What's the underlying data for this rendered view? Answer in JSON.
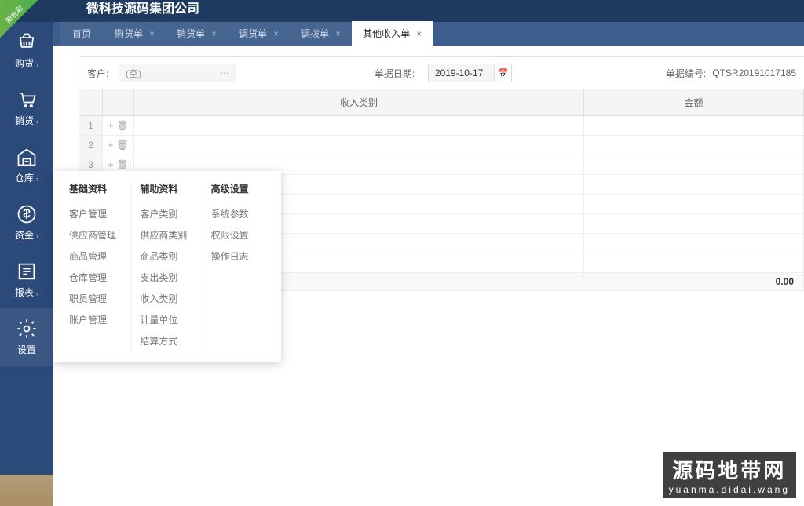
{
  "ribbon": "新色彩",
  "company": "微科技源码集团公司",
  "sidebar": [
    {
      "label": "购货",
      "icon": "basket"
    },
    {
      "label": "销货",
      "icon": "cart"
    },
    {
      "label": "仓库",
      "icon": "warehouse"
    },
    {
      "label": "资金",
      "icon": "money"
    },
    {
      "label": "报表",
      "icon": "report"
    },
    {
      "label": "设置",
      "icon": "gear"
    }
  ],
  "tabs": {
    "home": "首页",
    "items": [
      {
        "label": "购货单"
      },
      {
        "label": "销货单"
      },
      {
        "label": "调货单"
      },
      {
        "label": "调拨单"
      }
    ],
    "active": "其他收入单"
  },
  "form": {
    "customer_label": "客户:",
    "customer_value": "(空)",
    "date_label": "单据日期:",
    "date_value": "2019-10-17",
    "orderno_label": "单据编号:",
    "orderno_value": "QTSR20191017185"
  },
  "table": {
    "col_type": "收入类别",
    "col_amount": "金额",
    "rows": [
      1,
      2,
      3
    ],
    "total": "0.00"
  },
  "popup": {
    "cols": [
      {
        "title": "基础资料",
        "items": [
          "客户管理",
          "供应商管理",
          "商品管理",
          "仓库管理",
          "职员管理",
          "账户管理"
        ]
      },
      {
        "title": "辅助资料",
        "items": [
          "客户类别",
          "供应商类别",
          "商品类别",
          "支出类别",
          "收入类别",
          "计量单位",
          "结算方式"
        ]
      },
      {
        "title": "高级设置",
        "items": [
          "系统参数",
          "权限设置",
          "操作日志"
        ]
      }
    ]
  },
  "watermark": {
    "big": "源码地带网",
    "small": "yuanma.didai.wang"
  }
}
